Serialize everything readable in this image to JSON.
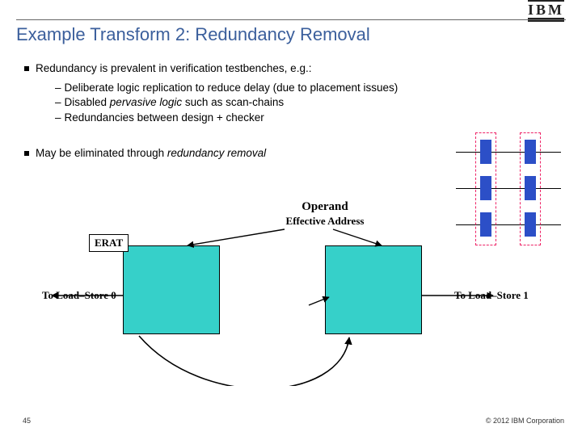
{
  "header": {
    "logo_text": "IBM"
  },
  "title": "Example Transform 2: Redundancy Removal",
  "bullets": {
    "b1": "Redundancy is prevalent in verification testbenches, e.g.:",
    "b1_subs": {
      "s1_pre": "Deliberate logic replication to reduce delay (due to placement issues)",
      "s2_pre": "Disabled ",
      "s2_em": "pervasive logic",
      "s2_post": " such as scan-chains",
      "s3": "Redundancies between design + checker"
    },
    "b2_pre": "May be eliminated through ",
    "b2_em": "redundancy removal"
  },
  "diagram": {
    "operand": "Operand",
    "eff_addr": "Effective Address",
    "erat": "ERAT",
    "ls0": "To Load–Store 0",
    "ls1": "To Load–Store 1"
  },
  "footer": {
    "page": "45",
    "copyright": "© 2012 IBM Corporation"
  }
}
